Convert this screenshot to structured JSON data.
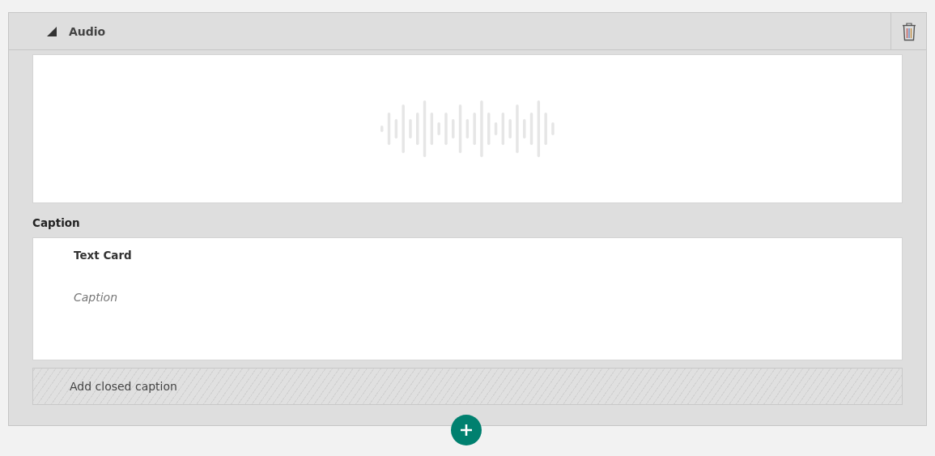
{
  "section": {
    "title": "Audio",
    "expanded": true
  },
  "caption_label": "Caption",
  "text_card": {
    "title": "Text Card",
    "placeholder": "Caption"
  },
  "closed_caption": {
    "label": "Add closed caption"
  }
}
